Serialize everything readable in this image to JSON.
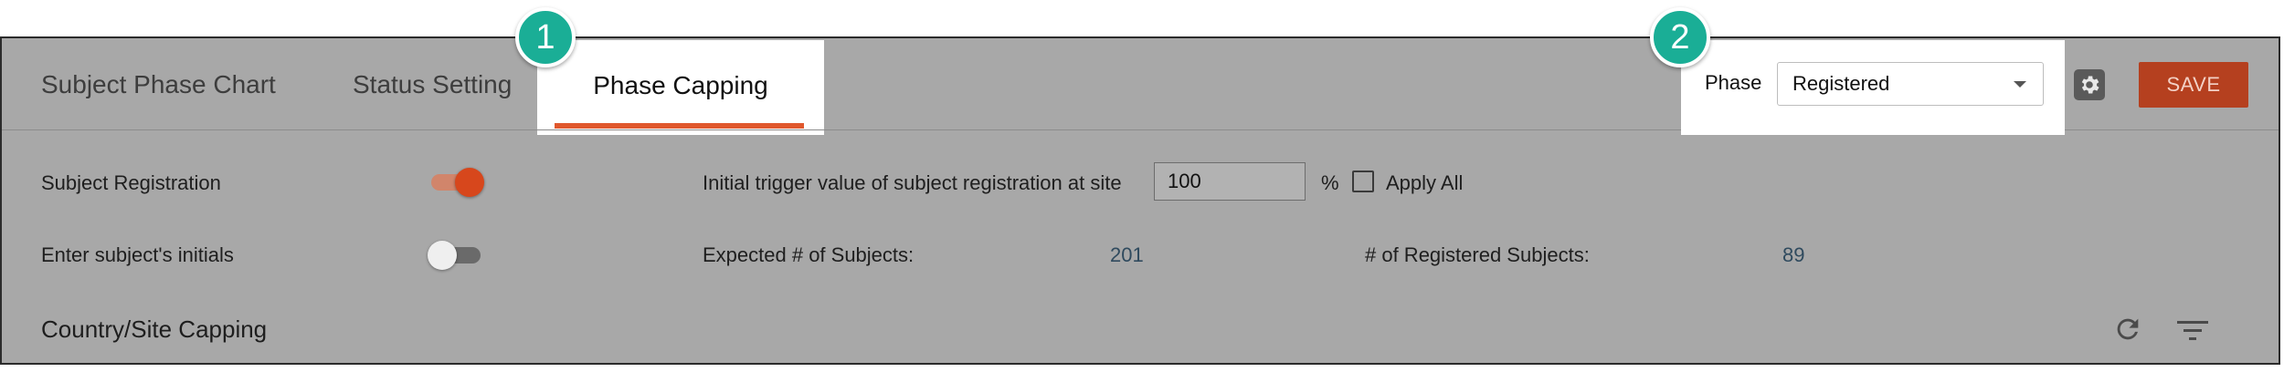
{
  "tabs": [
    {
      "label": "Subject Phase Chart"
    },
    {
      "label": "Status Setting"
    },
    {
      "label": "Phase Capping"
    }
  ],
  "badges": [
    "1",
    "2"
  ],
  "header": {
    "phase_label": "Phase",
    "phase_value": "Registered",
    "save_label": "SAVE"
  },
  "row1": {
    "label": "Subject Registration",
    "toggle_on": true,
    "trigger_label": "Initial trigger value of subject registration at site",
    "trigger_value": "100",
    "percent": "%",
    "apply_all": "Apply All"
  },
  "row2": {
    "label": "Enter subject's initials",
    "toggle_on": false,
    "expected_label": "Expected # of Subjects:",
    "expected_value": "201",
    "registered_label": "# of Registered Subjects:",
    "registered_value": "89"
  },
  "section": {
    "title": "Country/Site Capping"
  },
  "icons": [
    "gear-icon",
    "refresh-icon",
    "filter-icon",
    "chevron-down-icon"
  ],
  "colors": {
    "accent": "#e0582d",
    "save_bg": "#b5401f",
    "badge": "#1aae96",
    "panel_bg": "#a8a8a8"
  }
}
